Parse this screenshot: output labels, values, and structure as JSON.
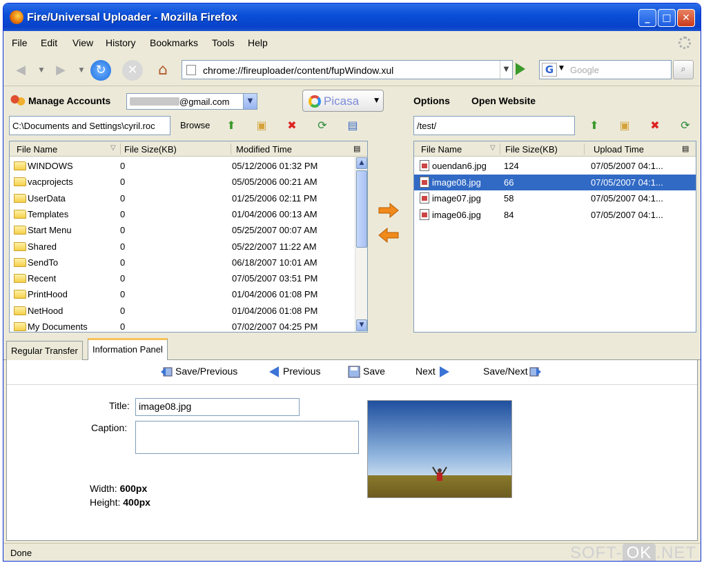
{
  "window": {
    "title": "Fire/Universal Uploader - Mozilla Firefox"
  },
  "menu": [
    "File",
    "Edit",
    "View",
    "History",
    "Bookmarks",
    "Tools",
    "Help"
  ],
  "nav": {
    "url": "chrome://fireuploader/content/fupWindow.xul",
    "search_placeholder": "Google",
    "search_engine_letter": "G"
  },
  "accounts": {
    "label": "Manage Accounts",
    "email_suffix": "@gmail.com",
    "service": "Picasa",
    "options_label": "Options",
    "open_website_label": "Open Website"
  },
  "local": {
    "path": "C:\\Documents and Settings\\cyril.roc",
    "browse_label": "Browse",
    "columns": [
      "File Name",
      "File Size(KB)",
      "Modified Time"
    ],
    "rows": [
      {
        "name": "WINDOWS",
        "size": "0",
        "time": "05/12/2006 01:32 PM"
      },
      {
        "name": "vacprojects",
        "size": "0",
        "time": "05/05/2006 00:21 AM"
      },
      {
        "name": "UserData",
        "size": "0",
        "time": "01/25/2006 02:11 PM"
      },
      {
        "name": "Templates",
        "size": "0",
        "time": "01/04/2006 00:13 AM"
      },
      {
        "name": "Start Menu",
        "size": "0",
        "time": "05/25/2007 00:07 AM"
      },
      {
        "name": "Shared",
        "size": "0",
        "time": "05/22/2007 11:22 AM"
      },
      {
        "name": "SendTo",
        "size": "0",
        "time": "06/18/2007 10:01 AM"
      },
      {
        "name": "Recent",
        "size": "0",
        "time": "07/05/2007 03:51 PM"
      },
      {
        "name": "PrintHood",
        "size": "0",
        "time": "01/04/2006 01:08 PM"
      },
      {
        "name": "NetHood",
        "size": "0",
        "time": "01/04/2006 01:08 PM"
      },
      {
        "name": "My Documents",
        "size": "0",
        "time": "07/02/2007 04:25 PM"
      }
    ]
  },
  "remote": {
    "path": "/test/",
    "columns": [
      "File Name",
      "File Size(KB)",
      "Upload Time"
    ],
    "rows": [
      {
        "name": "ouendan6.jpg",
        "size": "124",
        "time": "07/05/2007 04:1..."
      },
      {
        "name": "image08.jpg",
        "size": "66",
        "time": "07/05/2007 04:1..."
      },
      {
        "name": "image07.jpg",
        "size": "58",
        "time": "07/05/2007 04:1..."
      },
      {
        "name": "image06.jpg",
        "size": "84",
        "time": "07/05/2007 04:1..."
      }
    ],
    "selected_index": 1
  },
  "tabs": [
    "Regular Transfer",
    "Information Panel"
  ],
  "active_tab": 1,
  "info_toolbar": {
    "save_previous": "Save/Previous",
    "previous": "Previous",
    "save": "Save",
    "next": "Next",
    "save_next": "Save/Next"
  },
  "info_form": {
    "title_label": "Title:",
    "title_value": "image08.jpg",
    "caption_label": "Caption:",
    "caption_value": "",
    "width_label": "Width:",
    "width_value": "600px",
    "height_label": "Height:",
    "height_value": "400px"
  },
  "status": {
    "text": "Done"
  },
  "watermark": {
    "left": "SOFT-",
    "box": "OK",
    "right": ".NET"
  },
  "colors": {
    "selection": "#316ac5",
    "titlebar": "#0a4fd8",
    "accent_arrow": "#f08a1c"
  }
}
